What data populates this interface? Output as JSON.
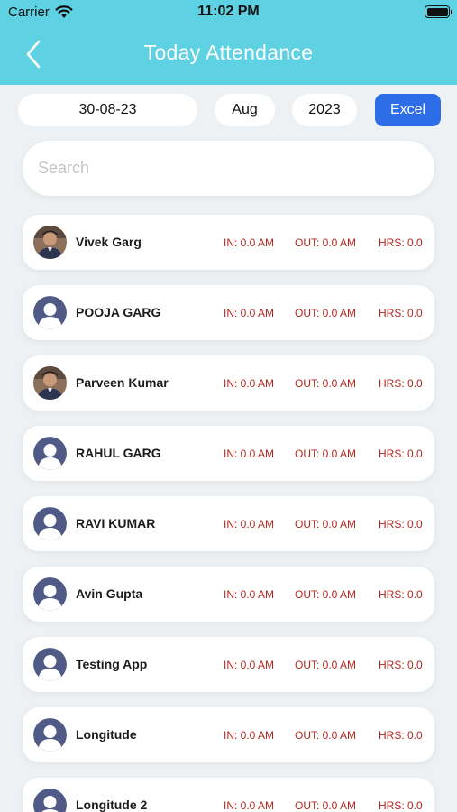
{
  "status_bar": {
    "carrier": "Carrier",
    "time": "11:02 PM"
  },
  "header": {
    "title": "Today Attendance"
  },
  "filters": {
    "date": "30-08-23",
    "month": "Aug",
    "year": "2023",
    "excel_label": "Excel"
  },
  "search": {
    "placeholder": "Search",
    "value": ""
  },
  "colors": {
    "header_bg": "#5ed1e2",
    "excel_button": "#2d6ee8",
    "stat_text": "#b3261e",
    "avatar_placeholder": "#4f5a86"
  },
  "employees": [
    {
      "name": "Vivek Garg",
      "in": "IN: 0.0 AM",
      "out": "OUT: 0.0 AM",
      "hrs": "HRS: 0.0",
      "avatar": "photo"
    },
    {
      "name": "POOJA GARG",
      "in": "IN: 0.0 AM",
      "out": "OUT: 0.0 AM",
      "hrs": "HRS: 0.0",
      "avatar": "placeholder"
    },
    {
      "name": "Parveen Kumar",
      "in": "IN: 0.0 AM",
      "out": "OUT: 0.0 AM",
      "hrs": "HRS: 0.0",
      "avatar": "photo"
    },
    {
      "name": "RAHUL GARG",
      "in": "IN: 0.0 AM",
      "out": "OUT: 0.0 AM",
      "hrs": "HRS: 0.0",
      "avatar": "placeholder"
    },
    {
      "name": "RAVI KUMAR",
      "in": "IN: 0.0 AM",
      "out": "OUT: 0.0 AM",
      "hrs": "HRS: 0.0",
      "avatar": "placeholder"
    },
    {
      "name": "Avin Gupta",
      "in": "IN: 0.0 AM",
      "out": "OUT: 0.0 AM",
      "hrs": "HRS: 0.0",
      "avatar": "placeholder"
    },
    {
      "name": "Testing App",
      "in": "IN: 0.0 AM",
      "out": "OUT: 0.0 AM",
      "hrs": "HRS: 0.0",
      "avatar": "placeholder"
    },
    {
      "name": "Longitude",
      "in": "IN: 0.0 AM",
      "out": "OUT: 0.0 AM",
      "hrs": "HRS: 0.0",
      "avatar": "placeholder"
    },
    {
      "name": "Longitude 2",
      "in": "IN: 0.0 AM",
      "out": "OUT: 0.0 AM",
      "hrs": "HRS: 0.0",
      "avatar": "placeholder"
    }
  ]
}
